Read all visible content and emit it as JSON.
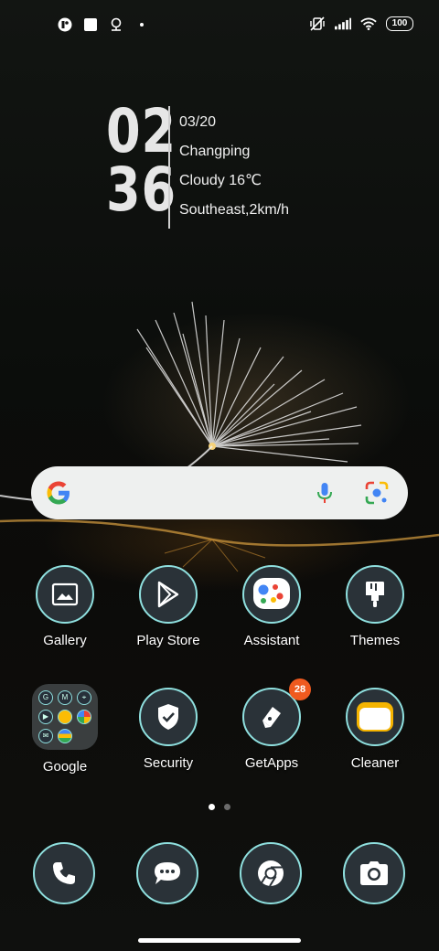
{
  "status_bar": {
    "battery": "100",
    "left_icons": [
      "cloud-app-icon",
      "square-notification-icon",
      "location-icon",
      "dot-icon"
    ],
    "right_icons": [
      "vibrate-off-icon",
      "signal-icon",
      "wifi-icon",
      "battery-icon"
    ]
  },
  "clock": {
    "hour": "02",
    "minute": "36",
    "date": "03/20",
    "city": "Changping",
    "weather": "Cloudy 16℃",
    "wind": "Southeast,2km/h"
  },
  "search": {
    "icons": [
      "google-g-icon",
      "microphone-icon",
      "google-lens-icon"
    ]
  },
  "apps_row1": [
    {
      "label": "Gallery",
      "icon": "gallery-icon"
    },
    {
      "label": "Play Store",
      "icon": "play-store-icon"
    },
    {
      "label": "Assistant",
      "icon": "assistant-icon"
    },
    {
      "label": "Themes",
      "icon": "themes-brush-icon"
    }
  ],
  "apps_row2": [
    {
      "label": "Google",
      "icon": "folder-icon"
    },
    {
      "label": "Security",
      "icon": "shield-icon"
    },
    {
      "label": "GetApps",
      "icon": "getapps-icon",
      "badge": "28"
    },
    {
      "label": "Cleaner",
      "icon": "cleaner-icon"
    }
  ],
  "folder_glyphs": [
    "G",
    "M",
    "⌖",
    "▶",
    "",
    "",
    "✉",
    "",
    ""
  ],
  "dock": [
    {
      "icon": "phone-icon"
    },
    {
      "icon": "messages-icon"
    },
    {
      "icon": "chrome-icon"
    },
    {
      "icon": "camera-icon"
    }
  ],
  "page_indicator": {
    "pages": 2,
    "current": 1
  },
  "colors": {
    "accent_ring": "#8fe0df",
    "badge": "#ef5a1f",
    "search_bg": "#eef0ef"
  }
}
